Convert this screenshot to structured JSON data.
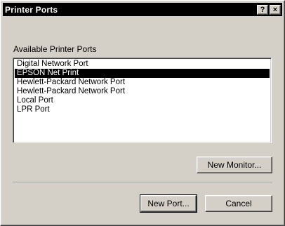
{
  "window": {
    "title": "Printer Ports",
    "help_button": "?",
    "close_button": "×"
  },
  "ports": {
    "label": "Available Printer Ports",
    "items": [
      "Digital Network Port",
      "EPSON Net Print",
      "Hewlett-Packard Network Port",
      "Hewlett-Packard Network Port",
      "Local Port",
      "LPR Port"
    ],
    "selected_index": 1
  },
  "buttons": {
    "new_monitor": "New Monitor...",
    "new_port": "New Port...",
    "cancel": "Cancel"
  }
}
